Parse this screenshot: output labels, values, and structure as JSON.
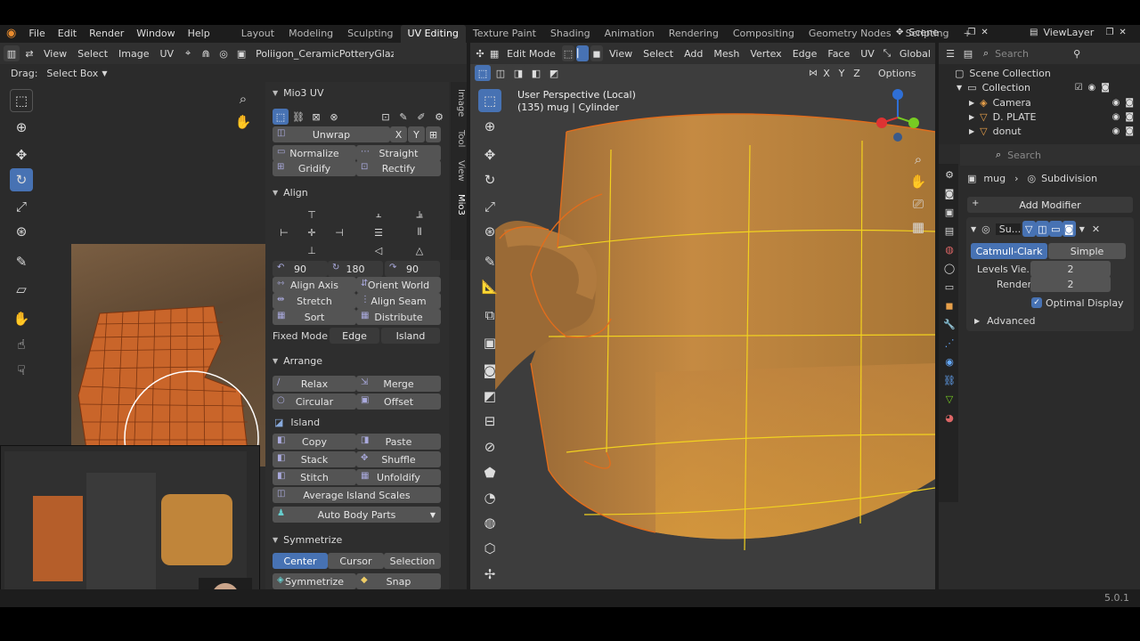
{
  "menu": [
    "File",
    "Edit",
    "Render",
    "Window",
    "Help"
  ],
  "workspaces": [
    "Layout",
    "Modeling",
    "Sculpting",
    "UV Editing",
    "Texture Paint",
    "Shading",
    "Animation",
    "Rendering",
    "Compositing",
    "Geometry Nodes",
    "Scripting"
  ],
  "active_workspace": "UV Editing",
  "add_tab": "+",
  "scene": "Scene",
  "view_layer": "ViewLayer",
  "uv_header": {
    "view": "View",
    "select": "Select",
    "image": "Image",
    "uv": "UV",
    "image_name": "Poliigon_CeramicPotteryGlazed_10"
  },
  "drag": {
    "label": "Drag:",
    "value": "Select Box"
  },
  "mio3": {
    "title": "Mio3 UV",
    "unwrap": "Unwrap",
    "x": "X",
    "y": "Y",
    "normalize": "Normalize",
    "straight": "Straight",
    "gridify": "Gridify",
    "rectify": "Rectify",
    "align_title": "Align",
    "rot1": "90",
    "rot2": "180",
    "rot3": "90",
    "align_axis": "Align Axis",
    "orient_world": "Orient World",
    "stretch": "Stretch",
    "align_seam": "Align Seam",
    "sort": "Sort",
    "distribute": "Distribute",
    "fixed_mode": "Fixed Mode",
    "edge": "Edge",
    "island": "Island",
    "arrange_title": "Arrange",
    "relax": "Relax",
    "merge": "Merge",
    "circular": "Circular",
    "offset": "Offset",
    "island_title": "Island",
    "copy": "Copy",
    "paste": "Paste",
    "stack": "Stack",
    "shuffle": "Shuffle",
    "stitch": "Stitch",
    "unfoldify": "Unfoldify",
    "avg_scales": "Average Island Scales",
    "auto_body": "Auto Body Parts",
    "sym_title": "Symmetrize",
    "center": "Center",
    "cursor": "Cursor",
    "selection": "Selection",
    "symmetrize": "Symmetrize",
    "snap": "Snap"
  },
  "sidebar_tabs": [
    "Image",
    "Tool",
    "View",
    "Mio3"
  ],
  "viewport": {
    "mode": "Edit Mode",
    "view": "View",
    "select": "Select",
    "add": "Add",
    "mesh": "Mesh",
    "vertex": "Vertex",
    "edge": "Edge",
    "face": "Face",
    "uv": "UV",
    "orientation": "Global",
    "x": "X",
    "y": "Y",
    "z": "Z",
    "options": "Options",
    "persp": "User Perspective (Local)",
    "obj": "(135) mug | Cylinder"
  },
  "outliner": {
    "search": "Search",
    "scene_collection": "Scene Collection",
    "items": [
      {
        "name": "Collection"
      },
      {
        "name": "Camera"
      },
      {
        "name": "D. PLATE"
      },
      {
        "name": "donut"
      }
    ]
  },
  "properties": {
    "search": "Search",
    "obj": "mug",
    "modifier_tab": "Subdivision",
    "add_modifier": "Add Modifier",
    "mod_name": "Su...",
    "catmull": "Catmull-Clark",
    "simple": "Simple",
    "levels_label": "Levels Vie...",
    "levels_val": "2",
    "render_label": "Render",
    "render_val": "2",
    "optimal": "Optimal Display",
    "advanced": "Advanced"
  },
  "version": "5.0.1",
  "colors": {
    "accent": "#4772b3",
    "header": "#303030",
    "panel": "#2b2b2b",
    "orange": "#e26d1c",
    "wire": "#f2d21f"
  }
}
